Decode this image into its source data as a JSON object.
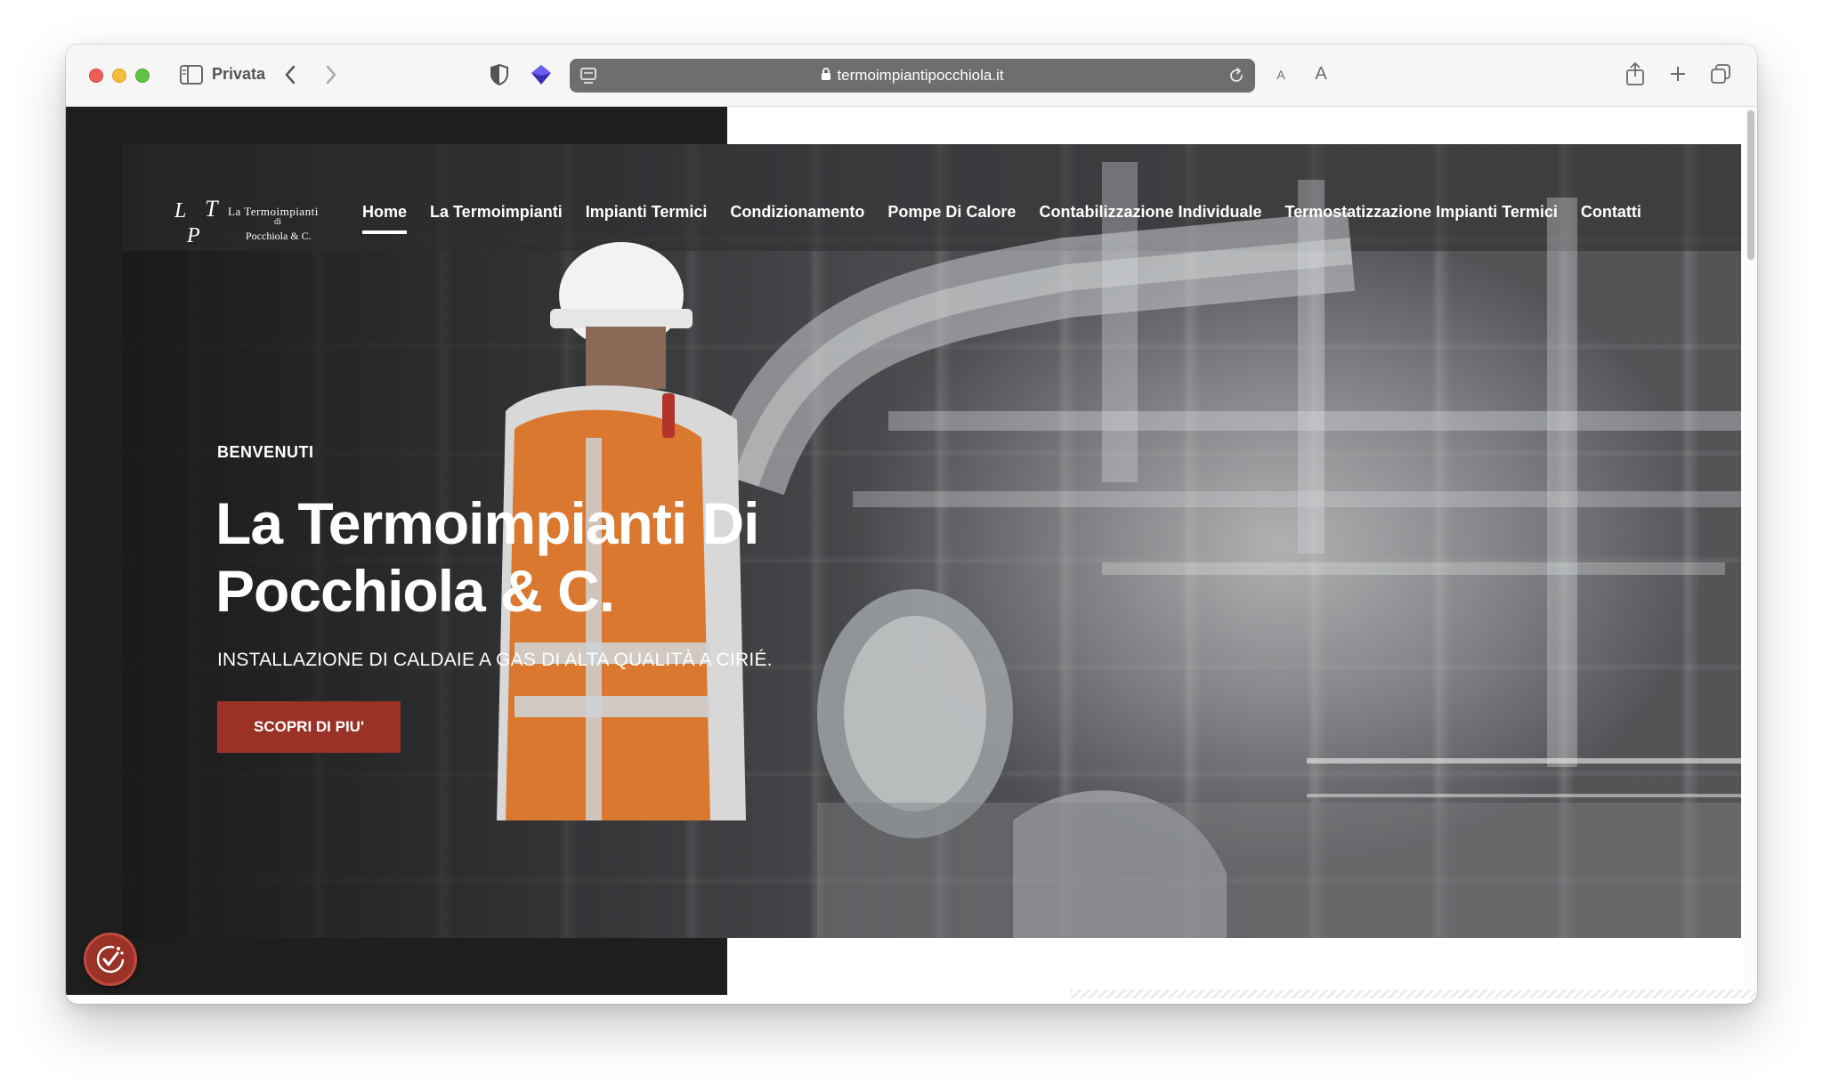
{
  "browser": {
    "mode_label": "Privata",
    "url": "termoimpiantipocchiola.it",
    "text_small": "A",
    "text_large": "A",
    "icons": [
      "sidebar-icon",
      "back-icon",
      "forward-icon",
      "shield-icon",
      "extension-icon",
      "tab-overview-icon",
      "lock-icon",
      "reload-icon",
      "share-icon",
      "new-tab-icon",
      "tabs-icon"
    ]
  },
  "site": {
    "logo": {
      "l": "L",
      "t": "T",
      "p": "P",
      "line1": "La Termoimpianti",
      "line2": "di",
      "line3": "Pocchiola & C."
    },
    "nav": [
      {
        "label": "Home",
        "active": true
      },
      {
        "label": "La Termoimpianti",
        "active": false
      },
      {
        "label": "Impianti Termici",
        "active": false
      },
      {
        "label": "Condizionamento",
        "active": false
      },
      {
        "label": "Pompe Di Calore",
        "active": false
      },
      {
        "label": "Contabilizzazione Individuale",
        "active": false
      },
      {
        "label": "Termostatizzazione Impianti Termici",
        "active": false
      },
      {
        "label": "Contatti",
        "active": false
      }
    ],
    "hero": {
      "eyebrow": "BENVENUTI",
      "title_line1": "La Termoimpianti Di",
      "title_line2": "Pocchiola & C.",
      "subtitle": "INSTALLAZIONE DI CALDAIE A GAS DI ALTA QUALITÀ A CIRIÉ.",
      "cta_label": "SCOPRI DI PIU'"
    },
    "cookie_icon": "cookie-consent-icon",
    "accent_color": "#9a3228"
  }
}
